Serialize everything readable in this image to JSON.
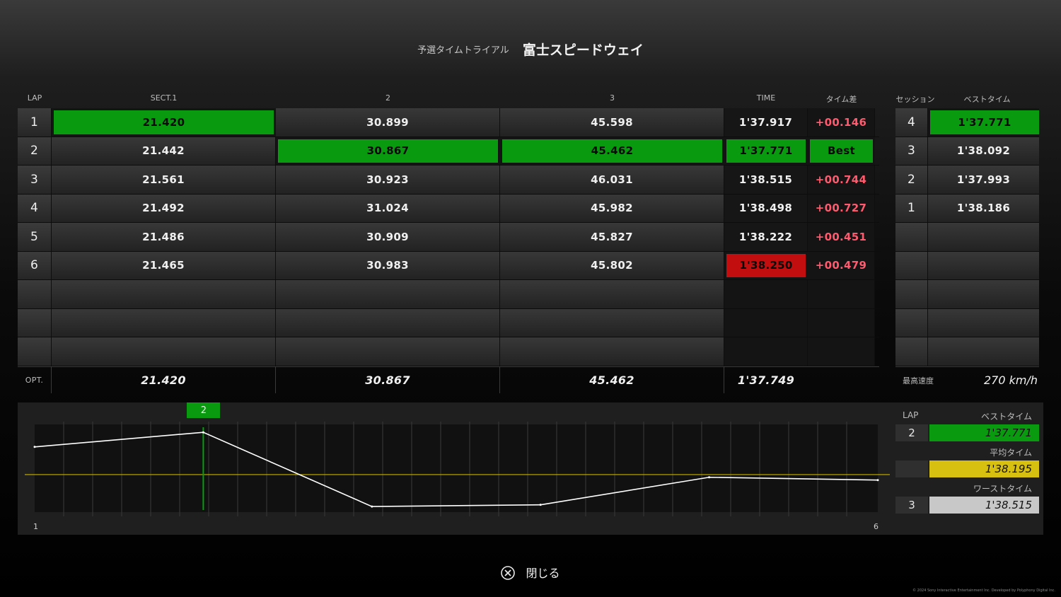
{
  "header": {
    "subtitle": "予選タイムトライアル",
    "track": "富士スピードウェイ"
  },
  "lap_table": {
    "columns": {
      "lap": "LAP",
      "sect1": "SECT.1",
      "sect2": "2",
      "sect3": "3",
      "time": "TIME",
      "diff": "タイム差"
    },
    "rows": [
      {
        "lap": "1",
        "s1": "21.420",
        "s2": "30.899",
        "s3": "45.598",
        "time": "1'37.917",
        "diff": "+00.146"
      },
      {
        "lap": "2",
        "s1": "21.442",
        "s2": "30.867",
        "s3": "45.462",
        "time": "1'37.771",
        "diff": "Best"
      },
      {
        "lap": "3",
        "s1": "21.561",
        "s2": "30.923",
        "s3": "46.031",
        "time": "1'38.515",
        "diff": "+00.744"
      },
      {
        "lap": "4",
        "s1": "21.492",
        "s2": "31.024",
        "s3": "45.982",
        "time": "1'38.498",
        "diff": "+00.727"
      },
      {
        "lap": "5",
        "s1": "21.486",
        "s2": "30.909",
        "s3": "45.827",
        "time": "1'38.222",
        "diff": "+00.451"
      },
      {
        "lap": "6",
        "s1": "21.465",
        "s2": "30.983",
        "s3": "45.802",
        "time": "1'38.250",
        "diff": "+00.479"
      }
    ],
    "opt": {
      "label": "OPT.",
      "s1": "21.420",
      "s2": "30.867",
      "s3": "45.462",
      "time": "1'37.749"
    }
  },
  "session_table": {
    "columns": {
      "session": "セッション",
      "best": "ベストタイム"
    },
    "rows": [
      {
        "session": "4",
        "best": "1'37.771"
      },
      {
        "session": "3",
        "best": "1'38.092"
      },
      {
        "session": "2",
        "best": "1'37.993"
      },
      {
        "session": "1",
        "best": "1'38.186"
      }
    ],
    "top_speed_label": "最高速度",
    "top_speed": "270 km/h"
  },
  "graph": {
    "marker": "2",
    "x_start": "1",
    "x_end": "6",
    "line_color": "#ffffff",
    "average_line_color": "#c8b000",
    "marker_color": "#0a9a10"
  },
  "chart_data": {
    "type": "line",
    "x": [
      1,
      2,
      3,
      4,
      5,
      6
    ],
    "series": [
      {
        "values": [
          97.917,
          97.771,
          98.515,
          98.498,
          98.222,
          98.25
        ]
      }
    ],
    "reference_line": 98.195,
    "highlight_x": 2,
    "xlim": [
      1,
      6
    ],
    "ylim": [
      97.72,
      98.55
    ]
  },
  "summary": {
    "lap_label": "LAP",
    "best_label": "ベストタイム",
    "best_lap": "2",
    "best_time": "1'37.771",
    "avg_label": "平均タイム",
    "avg_time": "1'38.195",
    "worst_label": "ワーストタイム",
    "worst_lap": "3",
    "worst_time": "1'38.515",
    "colors": {
      "best": "#0a9a10",
      "avg": "#d8c010",
      "worst": "#c8c8c8"
    }
  },
  "footer": {
    "close_label": "閉じる",
    "close_icon": "cross-button-icon",
    "copyright": "© 2024 Sony Interactive Entertainment Inc. Developed by Polyphony Digital Inc."
  }
}
